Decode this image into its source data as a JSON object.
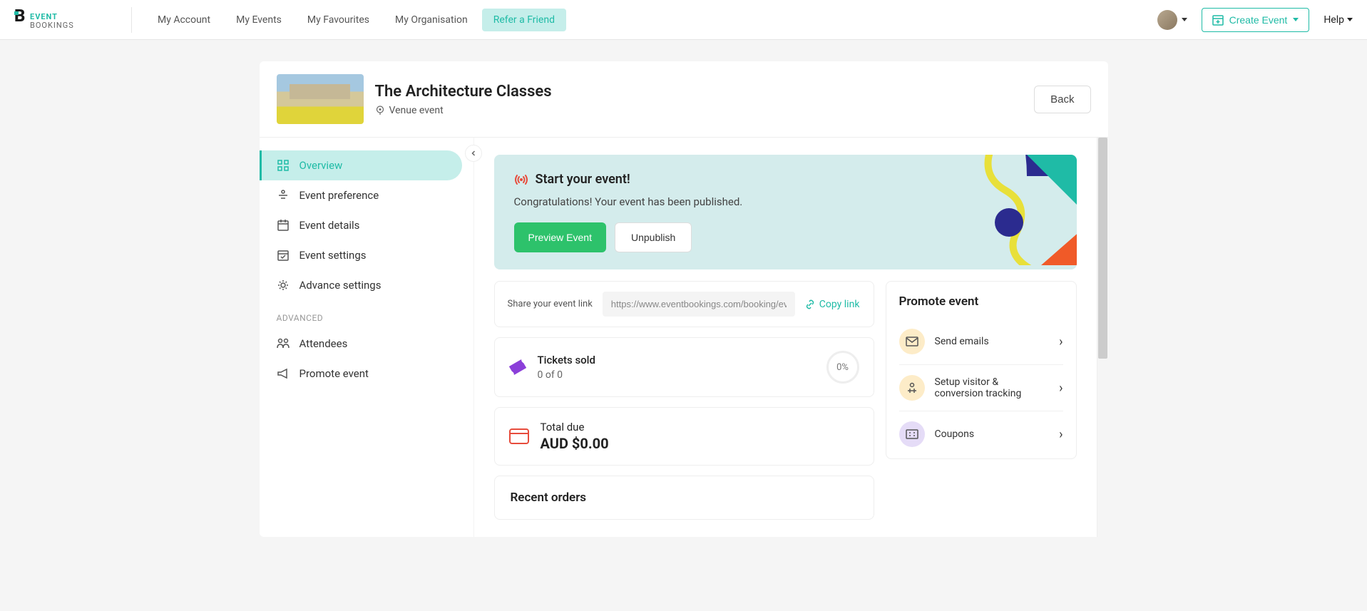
{
  "header": {
    "nav": [
      {
        "label": "My Account"
      },
      {
        "label": "My Events"
      },
      {
        "label": "My Favourites"
      },
      {
        "label": "My Organisation"
      },
      {
        "label": "Refer a Friend",
        "highlight": true
      }
    ],
    "create_event_label": "Create Event",
    "help_label": "Help"
  },
  "event": {
    "title": "The Architecture Classes",
    "subtitle": "Venue event",
    "back_label": "Back"
  },
  "sidebar": {
    "items": [
      {
        "label": "Overview",
        "active": true
      },
      {
        "label": "Event preference"
      },
      {
        "label": "Event details"
      },
      {
        "label": "Event settings"
      },
      {
        "label": "Advance settings"
      }
    ],
    "advanced_header": "ADVANCED",
    "advanced_items": [
      {
        "label": "Attendees"
      },
      {
        "label": "Promote event"
      }
    ]
  },
  "banner": {
    "title": "Start your event!",
    "subtitle": "Congratulations! Your event has been published.",
    "preview_label": "Preview Event",
    "unpublish_label": "Unpublish"
  },
  "share": {
    "label": "Share your event link",
    "url": "https://www.eventbookings.com/booking/eve",
    "copy_label": "Copy link"
  },
  "tickets": {
    "title": "Tickets sold",
    "count": "0 of 0",
    "percent": "0%"
  },
  "due": {
    "title": "Total due",
    "amount": "AUD $0.00"
  },
  "orders": {
    "title": "Recent orders"
  },
  "promote": {
    "title": "Promote event",
    "items": [
      {
        "label": "Send emails"
      },
      {
        "label": "Setup visitor & conversion tracking"
      },
      {
        "label": "Coupons"
      }
    ]
  }
}
